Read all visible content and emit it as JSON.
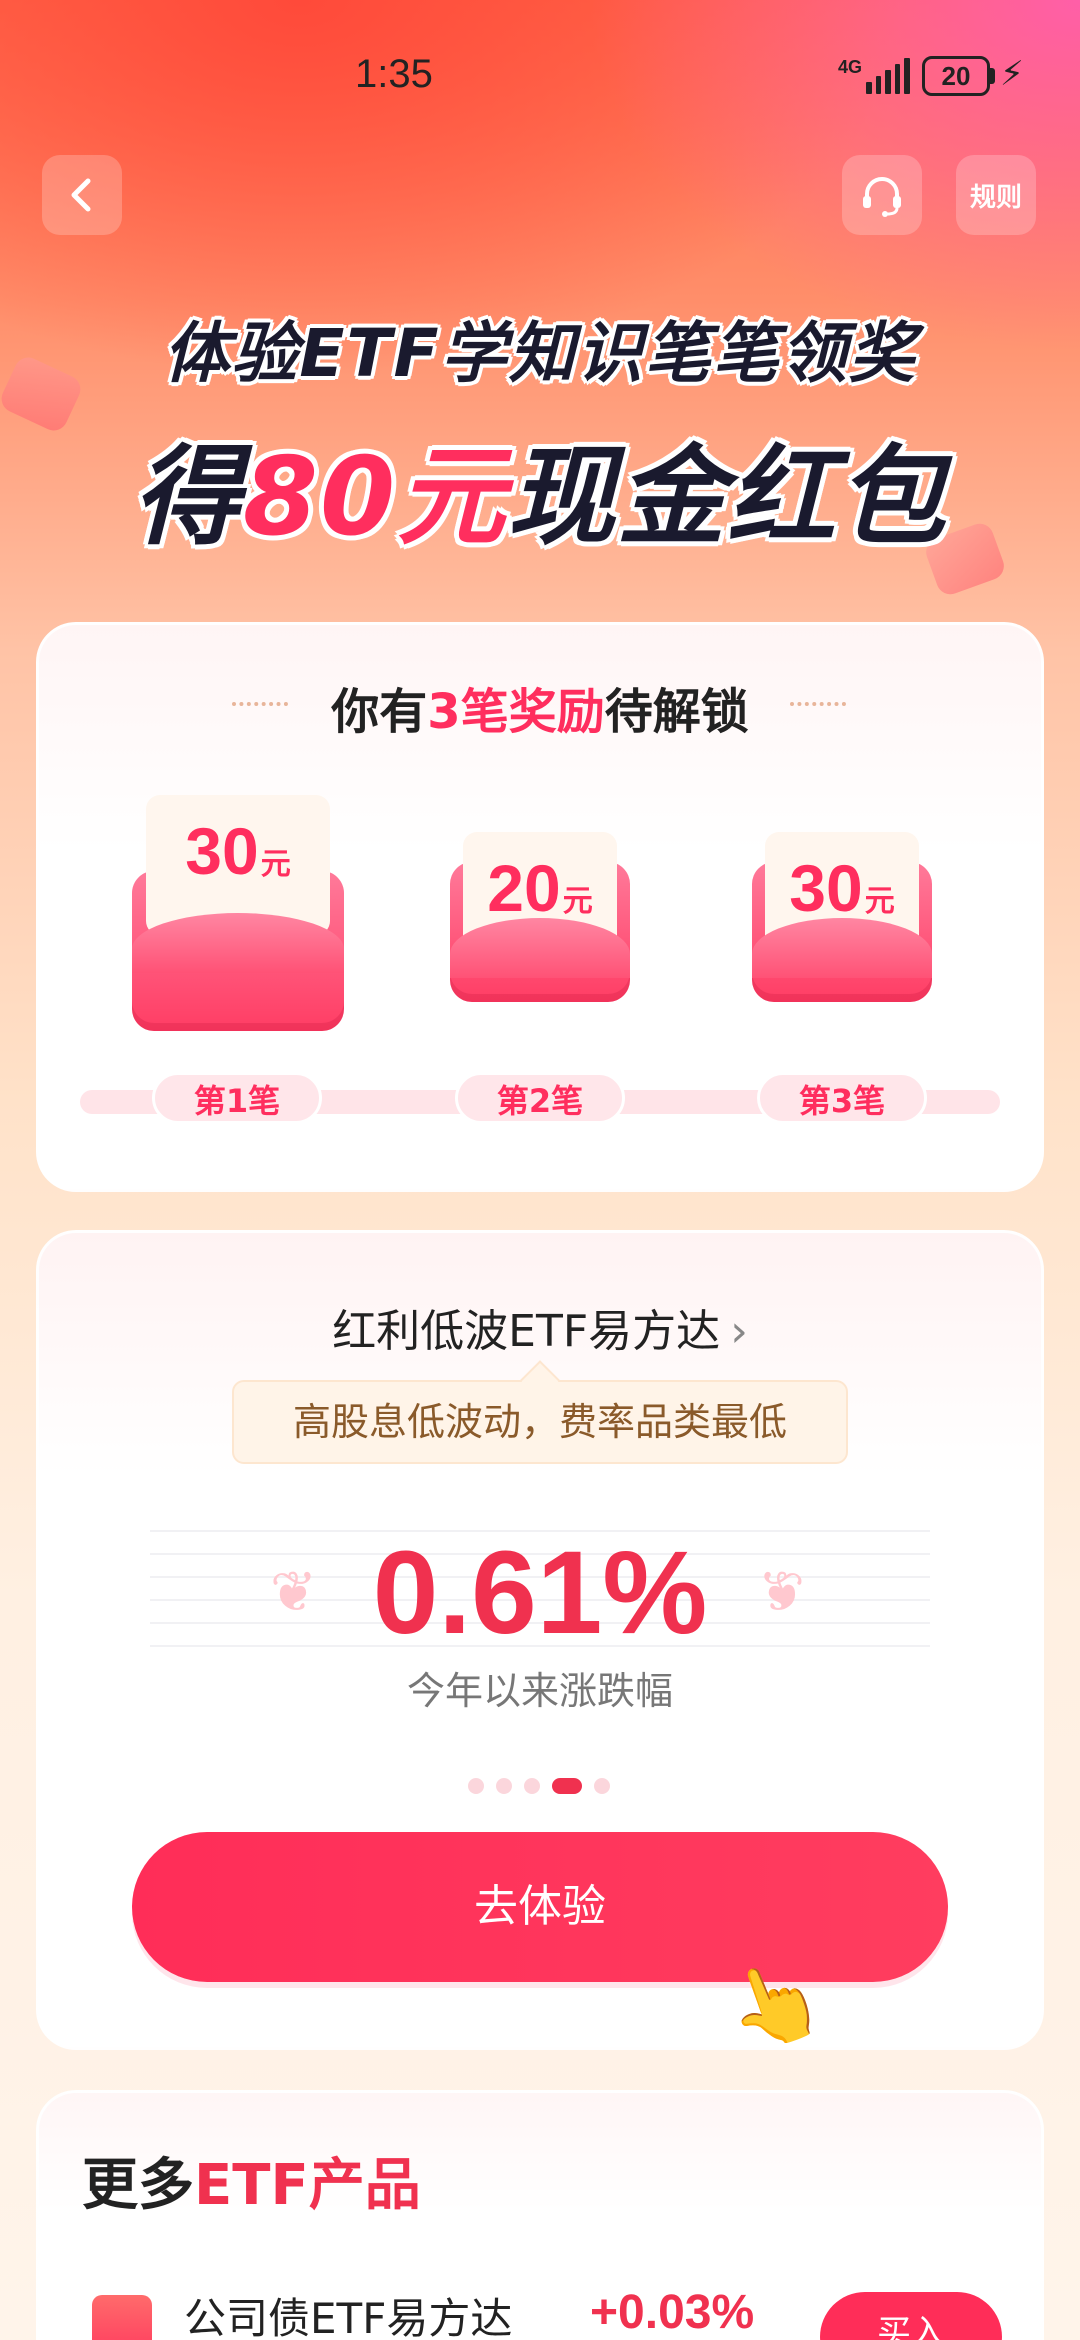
{
  "status_bar": {
    "time": "1:35",
    "network": "4G",
    "battery": "20"
  },
  "nav": {
    "back_icon": "chevron-left-icon",
    "service_icon": "headset-icon",
    "rules_label": "规则"
  },
  "headline": {
    "line1": "体验ETF学知识笔笔领奖",
    "line2_prefix": "得",
    "line2_highlight": "80元",
    "line2_suffix": "现金红包"
  },
  "rewards": {
    "title_prefix": "你有",
    "title_highlight": "3笔奖励",
    "title_suffix": "待解锁",
    "items": [
      {
        "amount": "30",
        "unit": "元",
        "label": "第1笔"
      },
      {
        "amount": "20",
        "unit": "元",
        "label": "第2笔"
      },
      {
        "amount": "30",
        "unit": "元",
        "label": "第3笔"
      }
    ]
  },
  "fund": {
    "name": "红利低波ETF易方达",
    "chevron": "›",
    "tag": "高股息低波动，费率品类最低",
    "return_value": "0.61%",
    "return_label": "今年以来涨跌幅",
    "pager_total": 5,
    "pager_active": 4,
    "cta_label": "去体验"
  },
  "more": {
    "title_prefix": "更多",
    "title_highlight": "ETF产品",
    "products": [
      {
        "name": "公司债ETF易方达",
        "change": "+0.03%",
        "button": "买入"
      }
    ]
  },
  "colors": {
    "accent": "#ff2e5e",
    "primary_text": "#222222",
    "tag_text": "#8a5a2a"
  }
}
